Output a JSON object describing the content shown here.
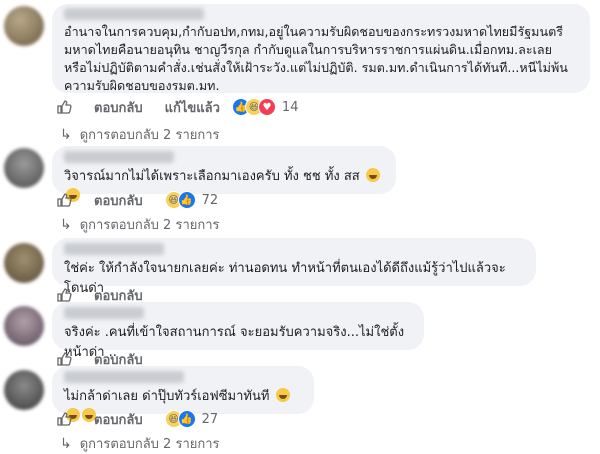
{
  "comments": [
    {
      "text": "อำนาจในการควบคุม,กำกับอปท,กทม,อยู่ในความรับผิดชอบของกระทรวงมหาดไทยมีรัฐมนตรีมหาดไทยคือนายอนุทิน ชาญวีรกุล กำกับดูแลในการบริหารราชการแผ่นดิน.เมื่อกทม.ละเลย หรือไม่ปฏิบัติตามคำสั่ง.เช่นสั่งให้เฝ้าระวัง.แต่ไม่ปฏิบัติ. รมต.มท.ดำเนินการได้ทันที...หนีไม่พ้นความรับผิดชอบของรมต.มท.",
      "reply_label": "ตอบกลับ",
      "edit_label": "แก้ไขแล้ว",
      "reaction_count": "14",
      "replies_label": "ดูการตอบกลับ 2 รายการ"
    },
    {
      "text": "วิจารณ์มากไม่ได้เพราะเลือกมาเองครับ ทั้ง ชช ทั้ง สส",
      "reply_label": "ตอบกลับ",
      "reaction_count": "72",
      "replies_label": "ดูการตอบกลับ 2 รายการ"
    },
    {
      "text": "ใช่ค่ะ ให้กำลังใจนายกเลยค่ะ ท่านอดทน ทำหน้าที่ตนเองได้ดีถึงแม้รู้ว่าไปแล้วจะโดนด่า",
      "reply_label": "ตอบกลับ"
    },
    {
      "text": "จริงค่ะ .คนที่เข้าใจสถานการณ์ จะยอมรับความจริง...ไม่ใช่ตั้งหน้าด่า ..",
      "reply_label": "ตอบกลับ"
    },
    {
      "text": "ไม่กล้าด่าเลย ด่าปุ๊บทัวร์เอฟซีมาทันที",
      "reply_label": "ตอบกลับ",
      "reaction_count": "27",
      "replies_label": "ดูการตอบกลับ 2 รายการ"
    }
  ],
  "colors": {
    "bubble": "#f0f2f5",
    "meta_text": "#65676b",
    "like_blue": "#1877f2",
    "love_red": "#f33e58",
    "haha_yellow": "#f7d15a"
  }
}
